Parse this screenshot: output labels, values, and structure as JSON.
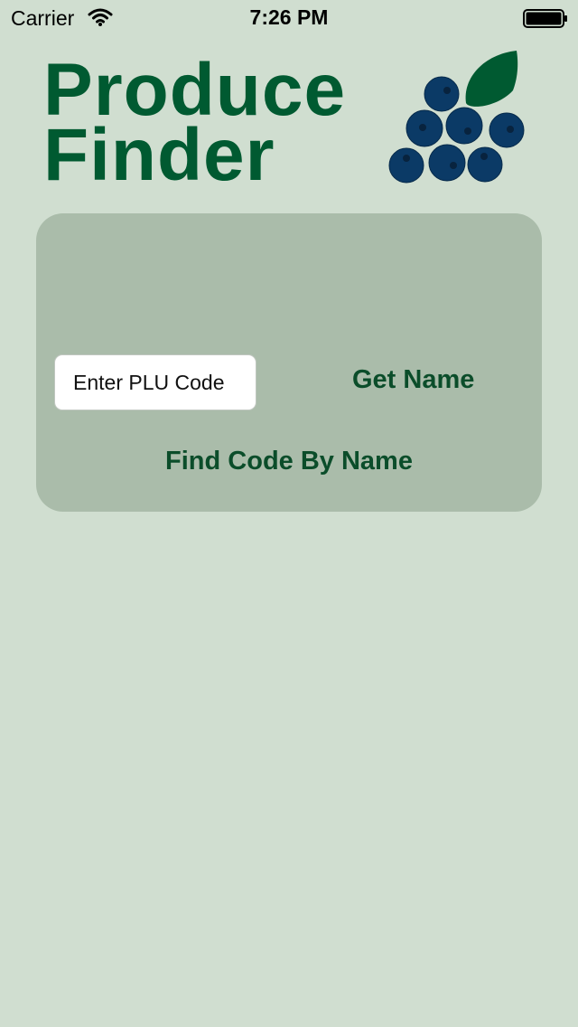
{
  "status_bar": {
    "carrier": "Carrier",
    "time": "7:26 PM",
    "icons": [
      "wifi-icon",
      "battery-icon"
    ]
  },
  "header": {
    "title_line1": "Produce",
    "title_line2": "Finder",
    "logo": "blueberry-cluster-logo"
  },
  "form": {
    "plu_placeholder": "Enter PLU Code",
    "plu_value": "",
    "get_name_label": "Get Name",
    "find_code_label": "Find Code By Name"
  },
  "colors": {
    "background": "#d0ded0",
    "panel": "#aabcaa",
    "brand_green": "#005a31",
    "button_text": "#0b4d2a",
    "berry": "#0b3a66",
    "leaf": "#005a31"
  }
}
